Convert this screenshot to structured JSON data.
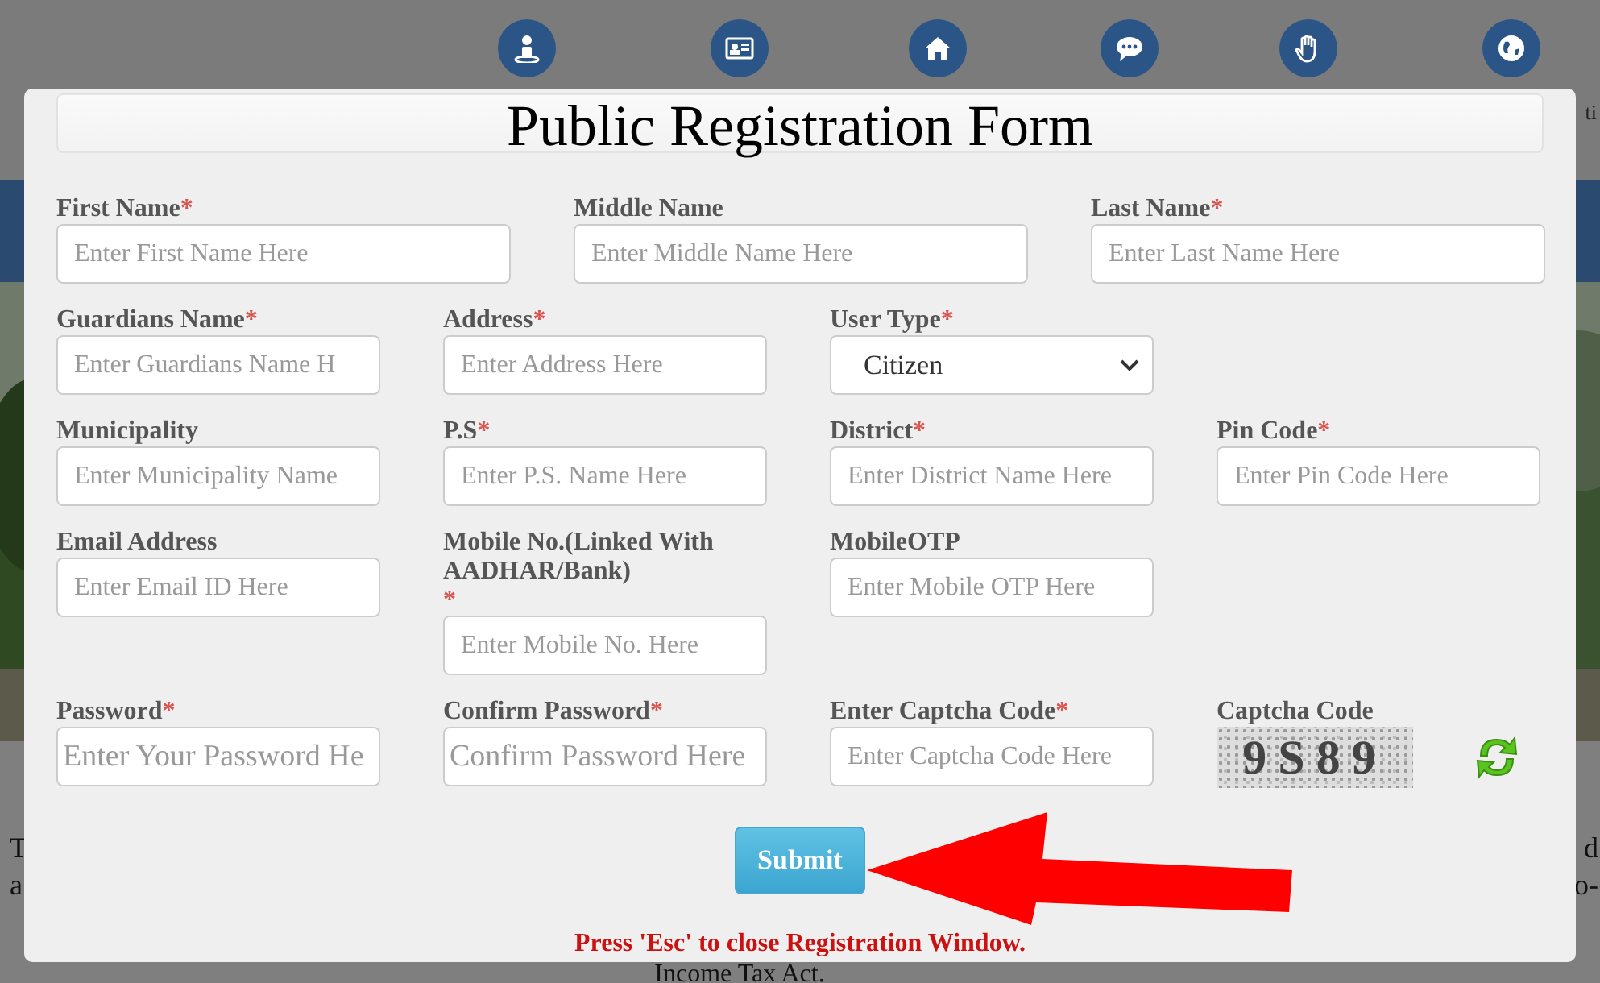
{
  "background": {
    "top_right_text": "ti",
    "left_lines": [
      "T",
      "a"
    ],
    "right_lines": [
      "d",
      "o-"
    ],
    "bottom_text": "Income Tax Act."
  },
  "modal": {
    "title": "Public Registration Form",
    "rows": [
      [
        {
          "kind": "text",
          "label": "First Name",
          "mark": "*",
          "placeholder": "Enter First Name Here"
        },
        {
          "kind": "text",
          "label": "Middle Name",
          "placeholder": "Enter Middle Name Here"
        },
        {
          "kind": "text",
          "label": "Last Name",
          "mark": "*",
          "placeholder": "Enter Last Name Here"
        }
      ],
      [
        {
          "kind": "text",
          "label": "Guardians Name",
          "mark": "*",
          "placeholder": "Enter Guardians Name H"
        },
        {
          "kind": "text",
          "label": "Address",
          "mark": "*",
          "placeholder": "Enter Address Here"
        },
        {
          "kind": "select",
          "label": "User Type",
          "mark": "*",
          "value": "Citizen"
        }
      ],
      [
        {
          "kind": "text",
          "label": "Municipality",
          "placeholder": "Enter Municipality Name"
        },
        {
          "kind": "text",
          "label": "P.S",
          "mark": "*",
          "placeholder": "Enter P.S. Name Here"
        },
        {
          "kind": "text",
          "label": "District",
          "mark": "*",
          "placeholder": "Enter District Name Here"
        },
        {
          "kind": "text",
          "label": "Pin Code",
          "mark": "*",
          "placeholder": "Enter Pin Code Here"
        }
      ],
      [
        {
          "kind": "text",
          "label": "Email Address",
          "placeholder": "Enter Email ID Here"
        },
        {
          "kind": "text",
          "label": "Mobile No.(Linked With AADHAR/Bank)",
          "mark": "*",
          "mark_wrapped": true,
          "placeholder": "Enter Mobile No. Here"
        },
        {
          "kind": "text",
          "label": "MobileOTP",
          "placeholder": "Enter Mobile OTP Here"
        }
      ],
      [
        {
          "kind": "password",
          "label": "Password",
          "mark": "*",
          "placeholder": "Enter Your Password He"
        },
        {
          "kind": "password",
          "label": "Confirm Password",
          "mark": "*",
          "placeholder": "Confirm Password Here"
        },
        {
          "kind": "text",
          "label": "Enter Captcha Code",
          "mark": "*",
          "placeholder": "Enter Captcha Code Here"
        },
        {
          "kind": "captcha",
          "label": "Captcha Code",
          "code": "9S89"
        }
      ]
    ],
    "submit": "Submit",
    "note": "Press 'Esc' to close Registration Window."
  }
}
